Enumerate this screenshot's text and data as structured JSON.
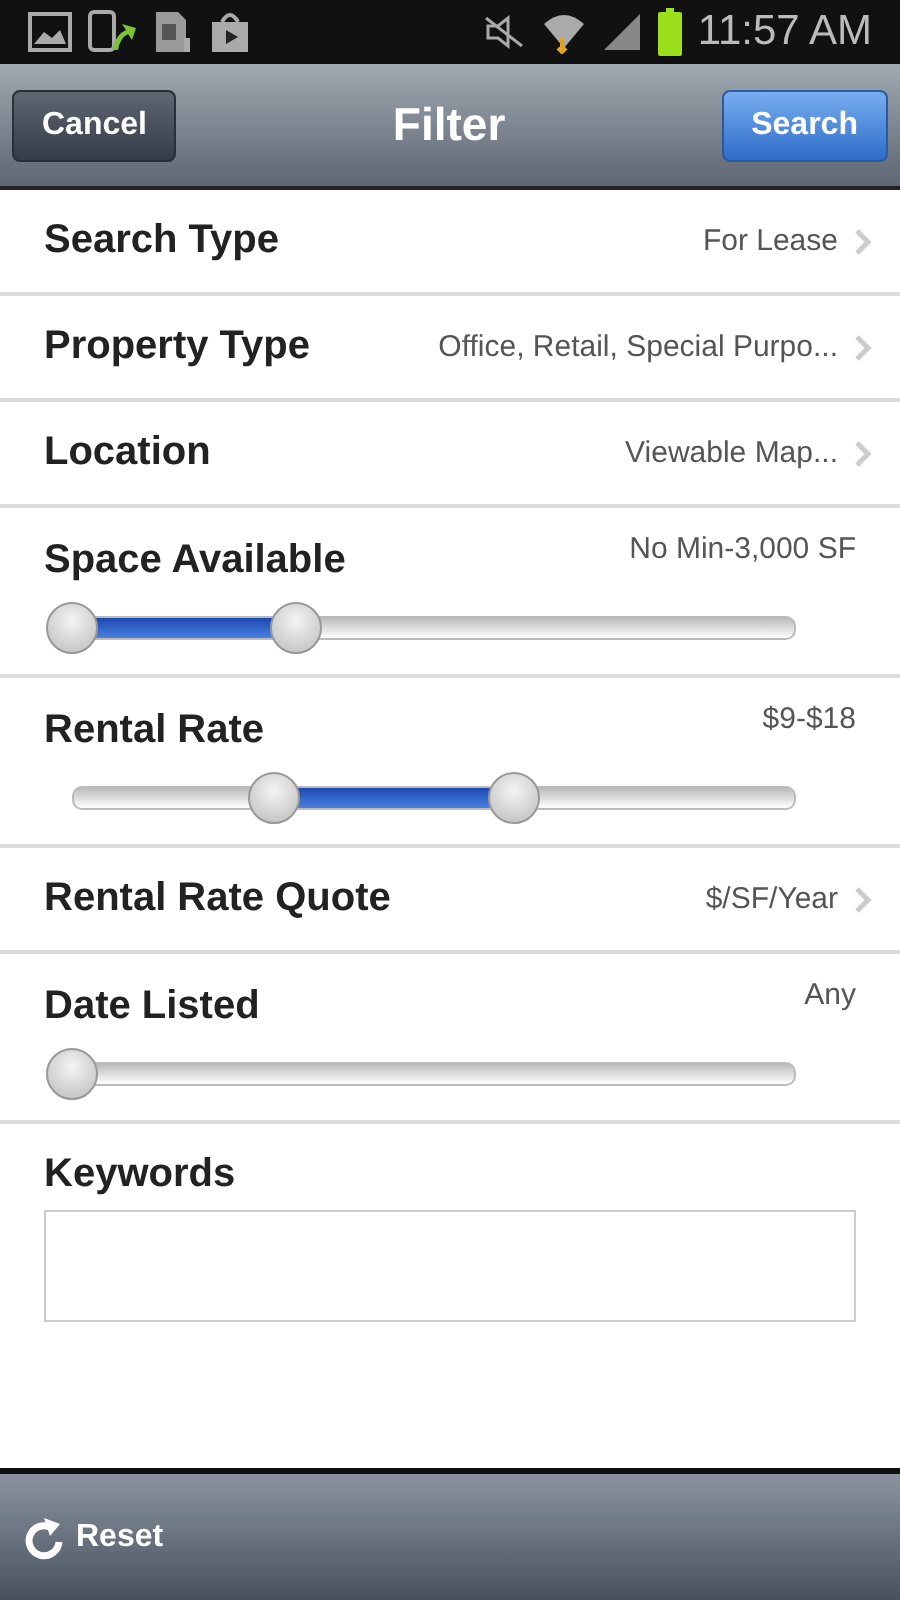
{
  "status_bar": {
    "time": "11:57 AM"
  },
  "header": {
    "cancel": "Cancel",
    "title": "Filter",
    "search": "Search"
  },
  "rows": [
    {
      "kind": "link",
      "label": "Search Type",
      "value": "For Lease"
    },
    {
      "kind": "link",
      "label": "Property Type",
      "value": "Office, Retail, Special Purpo..."
    },
    {
      "kind": "link",
      "label": "Location",
      "value": "Viewable Map..."
    },
    {
      "kind": "slider",
      "label": "Space Available",
      "value": "No Min-3,000 SF",
      "thumbs": [
        {
          "level": 0
        },
        {
          "level": 0.31
        }
      ]
    },
    {
      "kind": "slider",
      "label": "Rental Rate",
      "value": "$9-$18",
      "thumbs": [
        {
          "level": 0.28
        },
        {
          "level": 0.61
        }
      ]
    },
    {
      "kind": "link",
      "label": "Rental Rate Quote",
      "value": "$/SF/Year"
    },
    {
      "kind": "slider",
      "label": "Date Listed",
      "value": "Any",
      "thumbs": [
        {
          "level": 0
        }
      ]
    },
    {
      "kind": "text",
      "label": "Keywords"
    }
  ],
  "footer": {
    "reset": "Reset"
  }
}
